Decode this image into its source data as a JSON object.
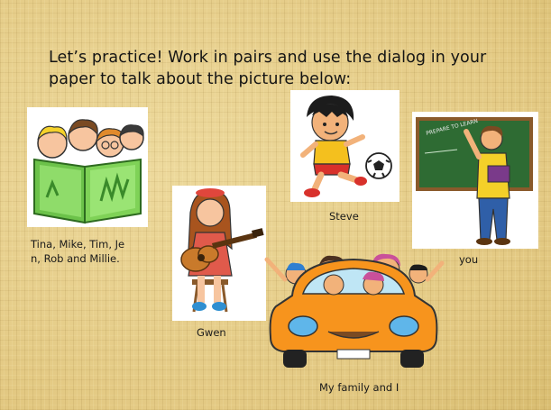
{
  "slide": {
    "instructions_line1": "Let’s practice! Work in pairs and use the dialog in your",
    "instructions_line2": "paper to talk about the picture below:"
  },
  "pictures": [
    {
      "icon": "kids-reading-book-icon",
      "caption_line1": "Tina, Mike, Tim, Je",
      "caption_line2": "n, Rob and Millie."
    },
    {
      "icon": "girl-playing-guitar-icon",
      "caption": "Gwen"
    },
    {
      "icon": "boy-kicking-soccer-ball-icon",
      "caption": "Steve"
    },
    {
      "icon": "teacher-at-chalkboard-icon",
      "caption": "you",
      "board_text": "PREPARE TO LEARN"
    },
    {
      "icon": "family-in-car-icon",
      "caption": "My family and I"
    }
  ],
  "colors": {
    "background": "#e6d08f",
    "book_green": "#6cc24a",
    "chalkboard_green": "#2e6b33",
    "car_orange": "#f7941d"
  }
}
